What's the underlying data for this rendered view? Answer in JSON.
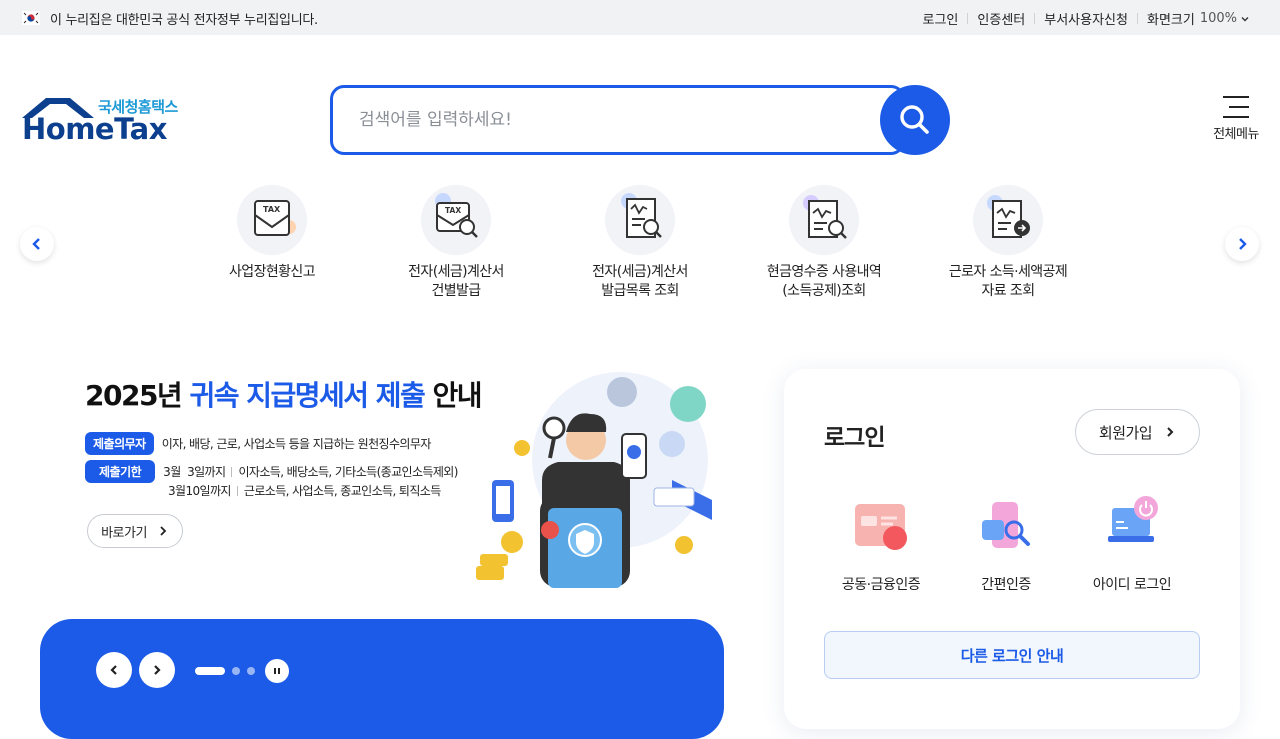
{
  "gov_bar": {
    "notice": "이 누리집은 대한민국 공식 전자정부 누리집입니다.",
    "links": [
      "로그인",
      "인증센터",
      "부서사용자신청"
    ],
    "zoom_label": "화면크기",
    "zoom_value": "100%"
  },
  "header": {
    "logo_ko": "국세청홈택스",
    "logo_en": "HomeTax",
    "search_placeholder": "검색어를 입력하세요!",
    "all_menu_label": "전체메뉴"
  },
  "quick_menu": [
    {
      "label": "사업장현황신고",
      "icon": "tax-envelope-icon"
    },
    {
      "label": "전자(세금)계산서\n건별발급",
      "icon": "tax-invoice-search-icon"
    },
    {
      "label": "전자(세금)계산서\n발급목록 조회",
      "icon": "receipt-search-icon"
    },
    {
      "label": "현금영수증 사용내역\n(소득공제)조회",
      "icon": "cash-receipt-search-icon"
    },
    {
      "label": "근로자 소득·세액공제\n자료 조회",
      "icon": "receipt-coin-icon"
    }
  ],
  "banner": {
    "title_year": "2025년",
    "title_highlight": "귀속 지급명세서 제출",
    "title_tail": "안내",
    "row1_tag": "제출의무자",
    "row1_text": "이자, 배당, 근로, 사업소득 등을 지급하는 원천징수의무자",
    "row2_tag": "제출기한",
    "row2_date": "3월  3일까지",
    "row2_text": "이자소득, 배당소득, 기타소득(종교인소득제외)",
    "row3_date": "3월10일까지",
    "row3_text": "근로소득, 사업소득, 종교인소득, 퇴직소득",
    "more_label": "바로가기"
  },
  "slider": {
    "slide_count": 3,
    "active_index": 0
  },
  "login_panel": {
    "title": "로그인",
    "join_label": "회원가입",
    "options": [
      {
        "label": "공동·금융인증",
        "icon": "certificate-card-icon"
      },
      {
        "label": "간편인증",
        "icon": "phone-auth-icon"
      },
      {
        "label": "아이디 로그인",
        "icon": "laptop-power-icon"
      }
    ],
    "other_label": "다른 로그인 안내"
  },
  "colors": {
    "primary": "#1c5be7",
    "logo_navy": "#0d3f8f",
    "logo_sky": "#1d9ad6"
  }
}
